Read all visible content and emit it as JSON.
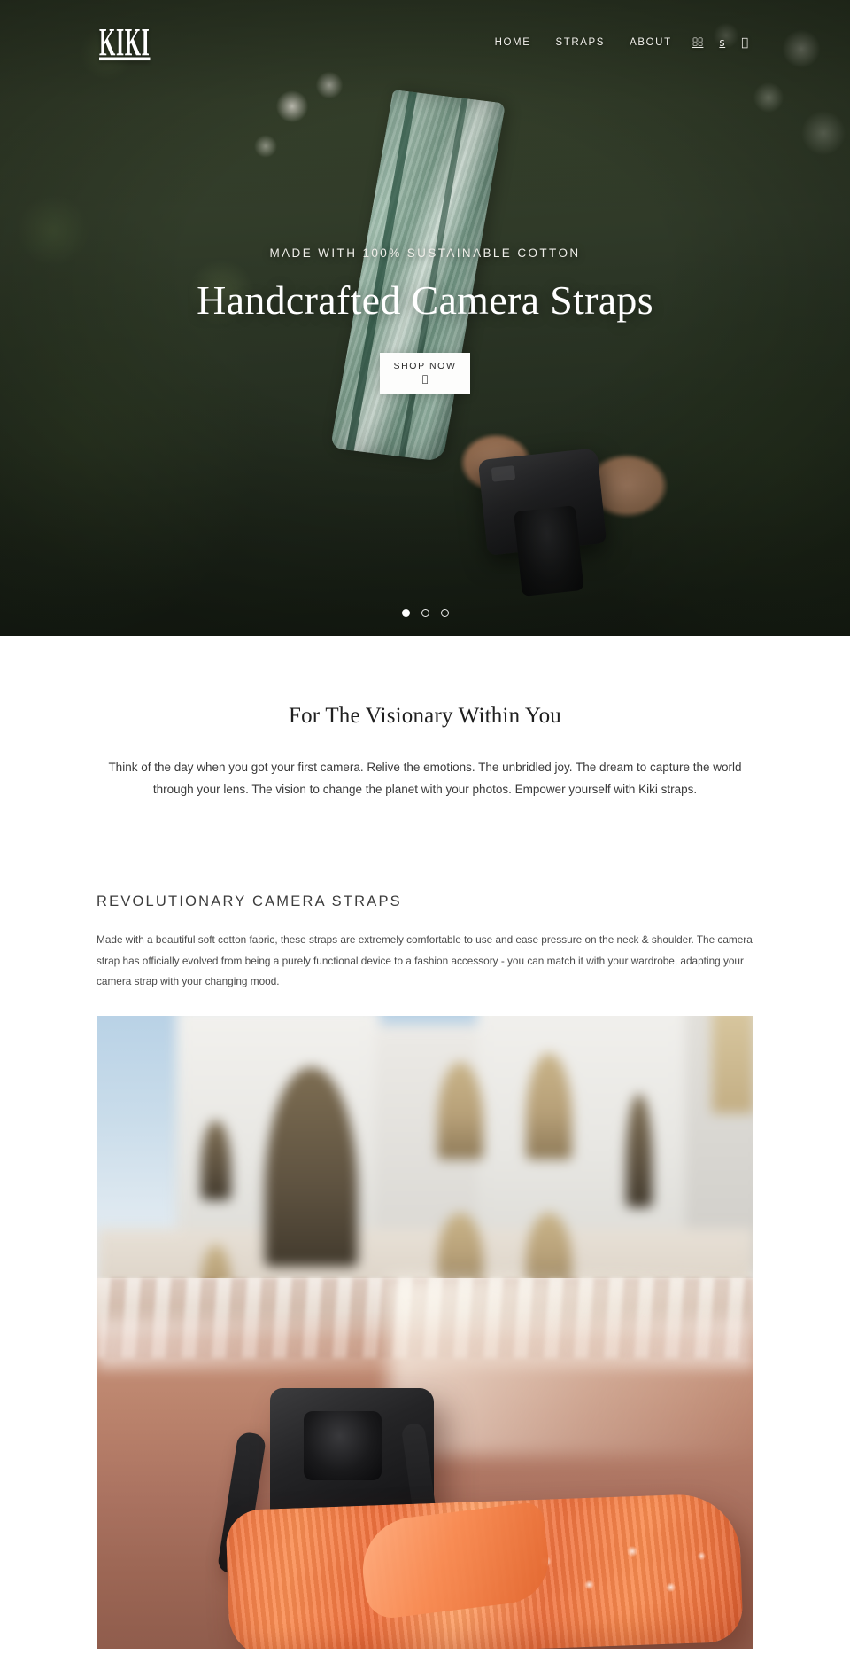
{
  "site": {
    "logo": "KIKI"
  },
  "nav": {
    "links": [
      {
        "label": "HOME",
        "name": "nav-link-home"
      },
      {
        "label": "STRAPS",
        "name": "nav-link-straps"
      },
      {
        "label": "ABOUT",
        "name": "nav-link-about"
      }
    ],
    "icons": [
      {
        "glyph": "",
        "name": "search-icon"
      },
      {
        "glyph": "s",
        "name": "currency-icon"
      },
      {
        "glyph": "",
        "name": "cart-icon"
      }
    ]
  },
  "hero": {
    "eyebrow": "MADE WITH 100% SUSTAINABLE COTTON",
    "title": "Handcrafted Camera Straps",
    "cta_label": "SHOP NOW",
    "cta_icon": "",
    "slides": [
      {
        "active": true
      },
      {
        "active": false
      },
      {
        "active": false
      }
    ]
  },
  "intro": {
    "title": "For The Visionary Within You",
    "body": "Think of the day when you got your first camera. Relive the emotions. The unbridled joy. The dream to capture the world through your lens. The vision to change the planet with your photos. Empower yourself with Kiki straps."
  },
  "feature": {
    "title": "REVOLUTIONARY CAMERA STRAPS",
    "body": "Made with a beautiful soft cotton fabric, these straps are extremely comfortable to use and ease pressure on the neck & shoulder.  The camera strap has officially evolved from being a purely functional device to a fashion accessory - you can match it with your wardrobe, adapting your camera strap with your changing mood."
  },
  "colors": {
    "page_background": "#ffffff",
    "hero_overlay": "#2c3626",
    "text_dark": "#1f1f1f",
    "text_body": "#3a3a3a",
    "button_background": "#fdfdfc",
    "accent_strap": "#ef7340"
  }
}
